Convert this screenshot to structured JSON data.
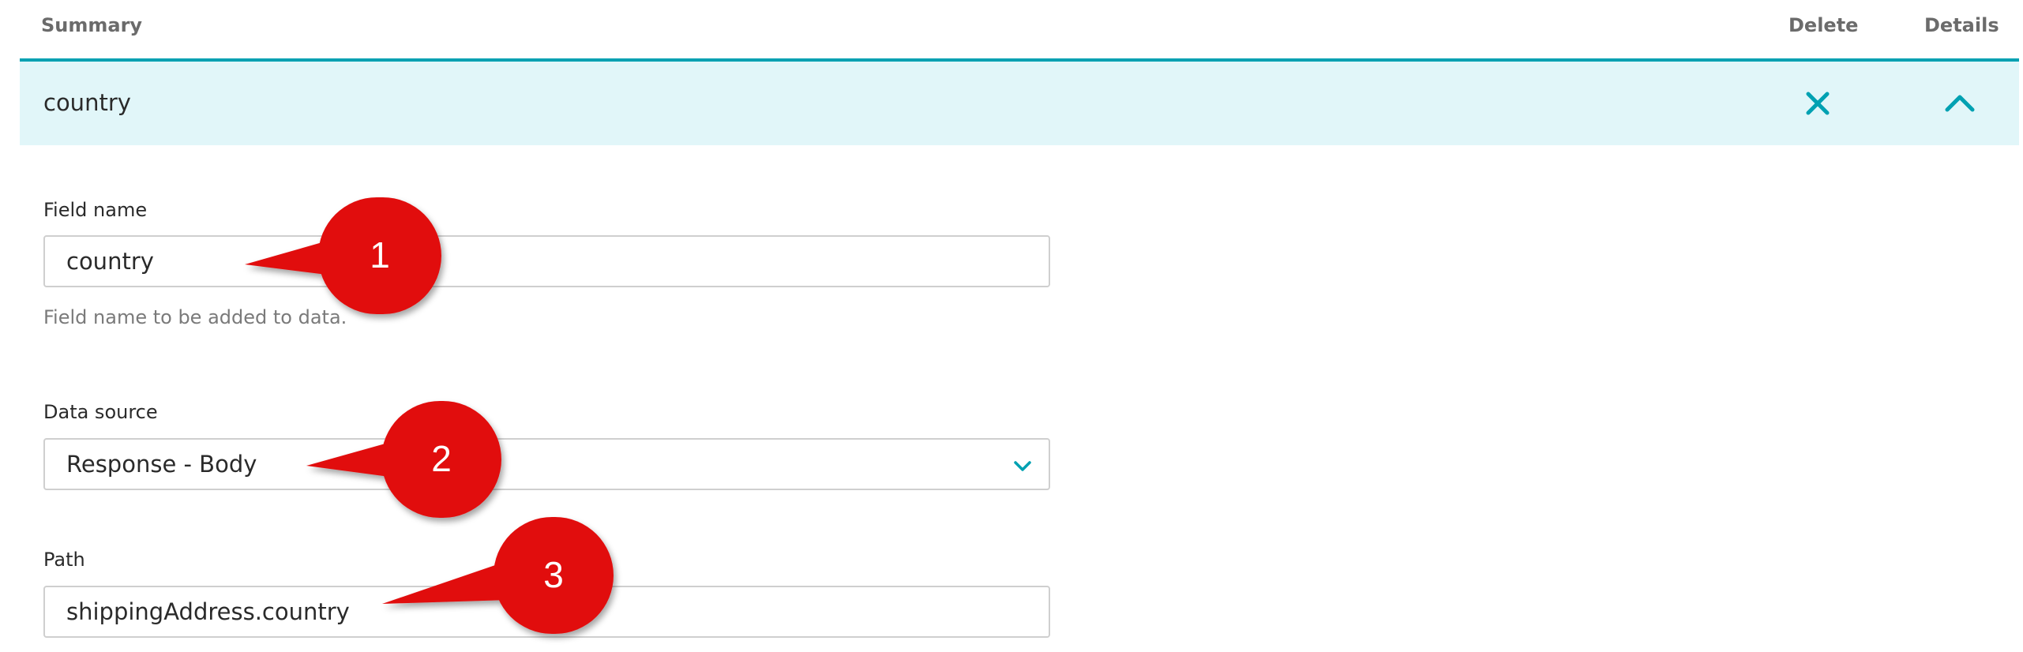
{
  "table": {
    "headers": {
      "summary": "Summary",
      "delete": "Delete",
      "details": "Details"
    },
    "row": {
      "title": "country"
    }
  },
  "form": {
    "field_name": {
      "label": "Field name",
      "value": "country",
      "help": "Field name to be added to data."
    },
    "data_source": {
      "label": "Data source",
      "value": "Response - Body"
    },
    "path": {
      "label": "Path",
      "value": "shippingAddress.country"
    }
  },
  "callouts": [
    "1",
    "2",
    "3"
  ],
  "icons": {
    "delete": "close-icon",
    "collapse": "chevron-up-icon",
    "dropdown": "chevron-down-icon"
  },
  "colors": {
    "accent": "#00a1b2",
    "row_bg": "#e1f6f9",
    "callout": "#e10c0c"
  }
}
